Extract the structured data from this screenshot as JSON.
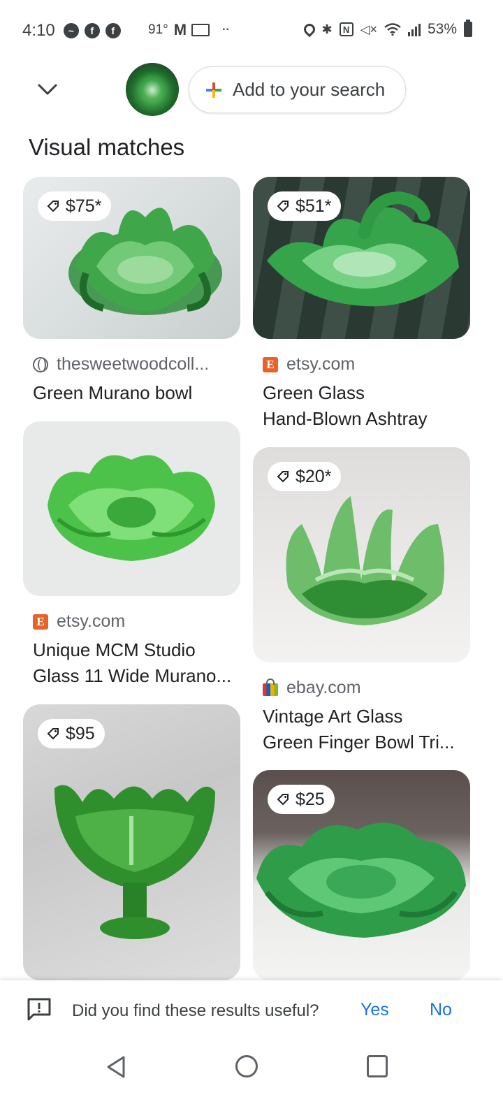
{
  "status_bar": {
    "time": "4:10",
    "temperature": "91°",
    "mail_glyph": "M",
    "nfc_glyph": "N",
    "overflow": "··",
    "battery": "53%"
  },
  "header": {
    "add_to_search_label": "Add to your search",
    "plus_colors": [
      "#4285f4",
      "#ea4335",
      "#fbbc05",
      "#34a853"
    ]
  },
  "section_title": "Visual matches",
  "results": [
    {
      "price": "$75*",
      "source": "thesweetwoodcoll...",
      "source_icon": "globe-icon",
      "title_lines": [
        "Green Murano bowl"
      ]
    },
    {
      "price": "$51*",
      "source": "etsy.com",
      "source_icon": "etsy-icon",
      "title_lines": [
        "Green Glass",
        "Hand-Blown Ashtray"
      ]
    },
    {
      "price": "",
      "source": "etsy.com",
      "source_icon": "etsy-icon",
      "title_lines": [
        "Unique MCM Studio",
        "Glass 11 Wide Murano..."
      ]
    },
    {
      "price": "$20*",
      "source": "ebay.com",
      "source_icon": "ebay-icon",
      "title_lines": [
        "Vintage Art Glass",
        "Green Finger Bowl Tri..."
      ]
    },
    {
      "price": "$95",
      "source": "",
      "source_icon": "",
      "title_lines": []
    },
    {
      "price": "$25",
      "source": "",
      "source_icon": "",
      "title_lines": []
    }
  ],
  "etsy_letter": "E",
  "feedback": {
    "question": "Did you find these results useful?",
    "yes": "Yes",
    "no": "No"
  }
}
